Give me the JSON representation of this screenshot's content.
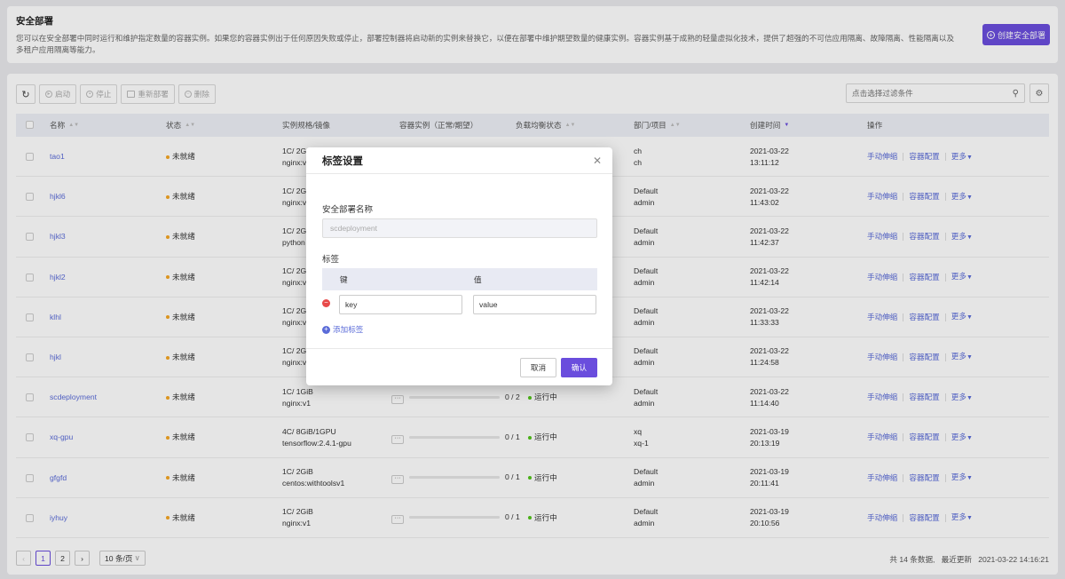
{
  "header": {
    "title": "安全部署",
    "description": "您可以在安全部署中同时运行和维护指定数量的容器实例。如果您的容器实例出于任何原因失败或停止，部署控制器将启动新的实例来替换它，以便在部署中维护期望数量的健康实例。容器实例基于成熟的轻量虚拟化技术，提供了超强的不可信应用隔离、故障隔离、性能隔离以及多租户应用隔离等能力。",
    "create_button": "创建安全部署"
  },
  "toolbar": {
    "refresh_icon": "refresh-icon",
    "start": "启动",
    "stop": "停止",
    "redeploy": "重新部署",
    "delete": "删除",
    "search_placeholder": "点击选择过滤条件",
    "settings_icon": "gear-icon"
  },
  "table": {
    "columns": [
      "名称",
      "状态",
      "实例规格/镜像",
      "容器实例（正常/期望）",
      "负载均衡状态",
      "部门/项目",
      "创建时间",
      "操作"
    ],
    "rows": [
      {
        "name": "tao1",
        "status": "未就绪",
        "spec": "1C/ 2G",
        "image": "nginx:v",
        "count": "",
        "lb": "",
        "dept": "ch",
        "project": "ch",
        "date": "2021-03-22",
        "time": "13:11:12"
      },
      {
        "name": "hjkl6",
        "status": "未就绪",
        "spec": "1C/ 2G",
        "image": "nginx:v",
        "count": "",
        "lb": "",
        "dept": "Default",
        "project": "admin",
        "date": "2021-03-22",
        "time": "11:43:02"
      },
      {
        "name": "hjkl3",
        "status": "未就绪",
        "spec": "1C/ 2G",
        "image": "python",
        "count": "",
        "lb": "",
        "dept": "Default",
        "project": "admin",
        "date": "2021-03-22",
        "time": "11:42:37"
      },
      {
        "name": "hjkl2",
        "status": "未就绪",
        "spec": "1C/ 2G",
        "image": "nginx:v",
        "count": "",
        "lb": "",
        "dept": "Default",
        "project": "admin",
        "date": "2021-03-22",
        "time": "11:42:14"
      },
      {
        "name": "klhl",
        "status": "未就绪",
        "spec": "1C/ 2G",
        "image": "nginx:v",
        "count": "",
        "lb": "",
        "dept": "Default",
        "project": "admin",
        "date": "2021-03-22",
        "time": "11:33:33"
      },
      {
        "name": "hjkl",
        "status": "未就绪",
        "spec": "1C/ 2G",
        "image": "nginx:v",
        "count": "",
        "lb": "",
        "dept": "Default",
        "project": "admin",
        "date": "2021-03-22",
        "time": "11:24:58"
      },
      {
        "name": "scdeployment",
        "status": "未就绪",
        "spec": "1C/ 1GiB",
        "image": "nginx:v1",
        "count": "0 / 2",
        "lb": "运行中",
        "dept": "Default",
        "project": "admin",
        "date": "2021-03-22",
        "time": "11:14:40"
      },
      {
        "name": "xq-gpu",
        "status": "未就绪",
        "spec": "4C/ 8GiB/1GPU",
        "image": "tensorflow:2.4.1-gpu",
        "count": "0 / 1",
        "lb": "运行中",
        "dept": "xq",
        "project": "xq-1",
        "date": "2021-03-19",
        "time": "20:13:19"
      },
      {
        "name": "gfgfd",
        "status": "未就绪",
        "spec": "1C/ 2GiB",
        "image": "centos:withtoolsv1",
        "count": "0 / 1",
        "lb": "运行中",
        "dept": "Default",
        "project": "admin",
        "date": "2021-03-19",
        "time": "20:11:41"
      },
      {
        "name": "iyhuy",
        "status": "未就绪",
        "spec": "1C/ 2GiB",
        "image": "nginx:v1",
        "count": "0 / 1",
        "lb": "运行中",
        "dept": "Default",
        "project": "admin",
        "date": "2021-03-19",
        "time": "20:10:56"
      }
    ],
    "actions": {
      "scale": "手动伸缩",
      "config": "容器配置",
      "more": "更多"
    }
  },
  "pagination": {
    "pages": [
      "1",
      "2"
    ],
    "page_size": "10 条/页",
    "total": "共 14 条数据,",
    "updated_label": "最近更新",
    "updated_time": "2021-03-22 14:16:21"
  },
  "modal": {
    "title": "标签设置",
    "name_label": "安全部署名称",
    "name_value": "scdeployment",
    "tags_label": "标签",
    "key_header": "键",
    "value_header": "值",
    "key_value": "key",
    "value_value": "value",
    "add_tag": "添加标签",
    "cancel": "取消",
    "confirm": "确认"
  },
  "colors": {
    "accent": "#6a4ddd",
    "link": "#5a6bd8",
    "warning": "#f5a623",
    "success": "#52c41a"
  }
}
